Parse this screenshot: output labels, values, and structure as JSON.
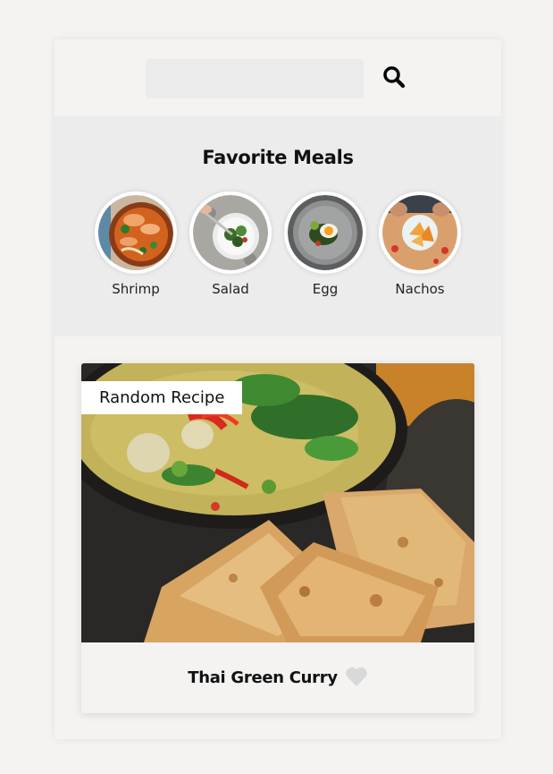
{
  "search": {
    "value": "",
    "placeholder": "",
    "icon": "search-icon"
  },
  "favorites": {
    "title": "Favorite Meals",
    "items": [
      {
        "label": "Shrimp"
      },
      {
        "label": "Salad"
      },
      {
        "label": "Egg"
      },
      {
        "label": "Nachos"
      }
    ]
  },
  "random_meal": {
    "tag": "Random Recipe",
    "title": "Thai Green Curry",
    "favorite_icon": "heart-icon",
    "favorited": false
  },
  "colors": {
    "background": "#f4f3f2",
    "favorites_background": "#ececec",
    "search_input": "#ebebeb",
    "heart_inactive": "#d9d9d9",
    "text": "#111111"
  }
}
